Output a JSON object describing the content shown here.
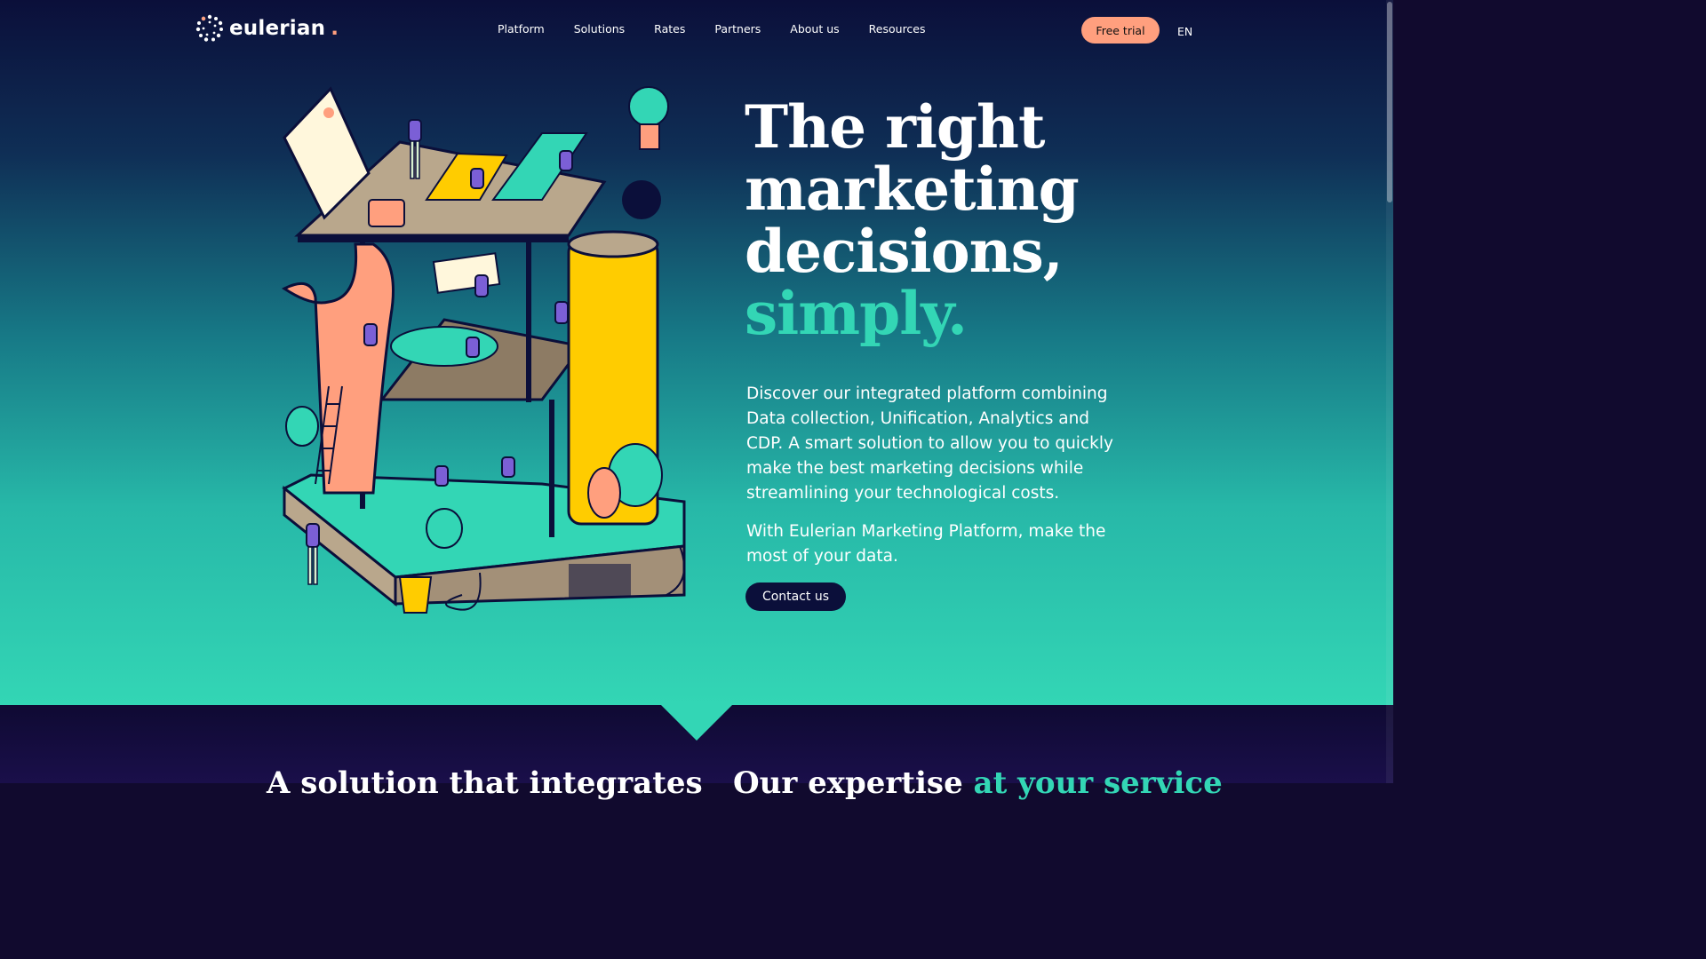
{
  "brand": {
    "name": "eulerian",
    "dot": ".",
    "accent": "#ff9f7e",
    "teal": "#33d6b5"
  },
  "nav": {
    "items": [
      "Platform",
      "Solutions",
      "Rates",
      "Partners",
      "About us",
      "Resources"
    ],
    "cta": "Free trial",
    "lang": "EN"
  },
  "hero": {
    "headline_lines": [
      "The right",
      "marketing",
      "decisions,"
    ],
    "headline_accent": "simply.",
    "description": "Discover our integrated platform combining Data collection, Unification, Analytics and CDP. A smart solution to allow you to quickly make the best marketing decisions while streamlining your technological costs.",
    "description2": "With Eulerian Marketing Platform, make the most of your data.",
    "contact": "Contact us"
  },
  "sections": {
    "left_title": "A solution that integrates",
    "right_title": "Our expertise",
    "right_title_accent": "at your service"
  }
}
